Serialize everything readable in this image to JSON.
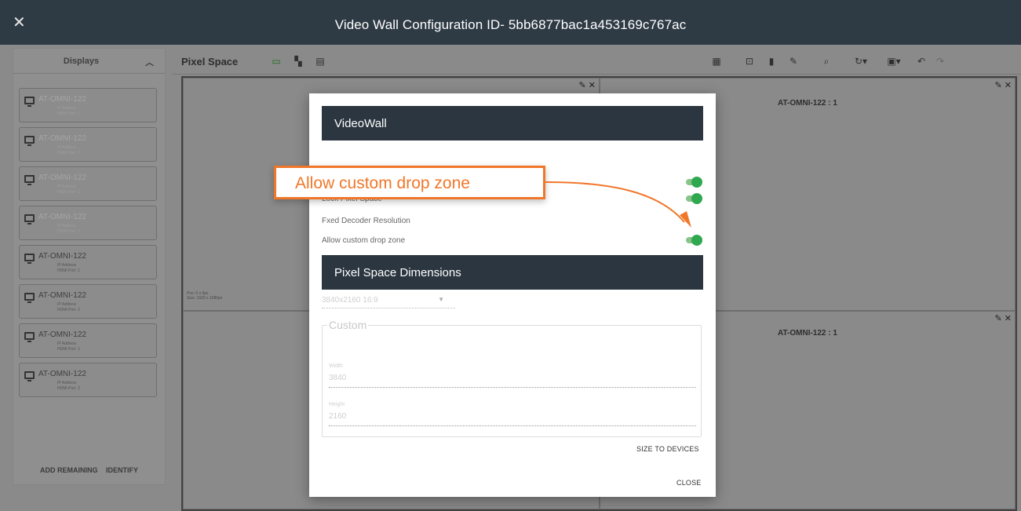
{
  "window": {
    "title": "Video Wall Configuration ID- 5bb6877bac1a453169c767ac",
    "close_icon": "close-icon"
  },
  "sidebar": {
    "header": "Displays",
    "collapse_icon": "chevron-up-icon",
    "items": [
      {
        "name": "AT-OMNI-122",
        "ip_label": "IP Address",
        "port_label": "HDMI Port",
        "port": "1"
      },
      {
        "name": "AT-OMNI-122",
        "ip_label": "IP Address",
        "port_label": "HDMI Port",
        "port": "1"
      },
      {
        "name": "AT-OMNI-122",
        "ip_label": "IP Address",
        "port_label": "HDMI Port",
        "port": "1"
      },
      {
        "name": "AT-OMNI-122",
        "ip_label": "IP Address",
        "port_label": "HDMI Port",
        "port": "1"
      },
      {
        "name": "AT-OMNI-122",
        "ip_label": "IP Address",
        "port_label": "HDMI Port",
        "port": "1"
      },
      {
        "name": "AT-OMNI-122",
        "ip_label": "IP Address",
        "port_label": "HDMI Port",
        "port": "2"
      },
      {
        "name": "AT-OMNI-122",
        "ip_label": "IP Address",
        "port_label": "HDMI Port",
        "port": "1"
      },
      {
        "name": "AT-OMNI-122",
        "ip_label": "IP Address",
        "port_label": "HDMI Port",
        "port": "2"
      }
    ],
    "add_remaining": "ADD REMAINING",
    "identify": "IDENTIFY"
  },
  "toolbar": {
    "title": "Pixel Space",
    "left_icons": [
      "monitor-icon",
      "grid-4-icon",
      "grid-list-icon"
    ],
    "right_icons": [
      "grid-9-icon",
      "lock-icon",
      "trash-icon",
      "pencil-icon",
      "zoom-icon",
      "rotate-icon",
      "save-icon",
      "undo-icon",
      "redo-icon"
    ]
  },
  "canvas": {
    "cells": [
      {
        "label": "",
        "pos": "Pos: 0 x 0px",
        "size": "Size: 1920 x 1080px"
      },
      {
        "label": "AT-OMNI-122 : 1"
      },
      {
        "label": ""
      },
      {
        "label": "AT-OMNI-122 : 1"
      }
    ]
  },
  "modal": {
    "header": "VideoWall",
    "rows": [
      {
        "label": "Lock Pixel Space",
        "enabled": true
      },
      {
        "label": "Fxed Decoder Resolution"
      },
      {
        "label": "Allow custom drop zone",
        "enabled": true
      }
    ],
    "dimensions_header": "Pixel Space Dimensions",
    "preset_value": "3840x2160 16:9",
    "custom_legend": "Custom",
    "width_label": "Width",
    "width_value": "3840",
    "height_label": "Height",
    "height_value": "2160",
    "size_to_devices": "SIZE TO DEVICES",
    "close": "CLOSE"
  },
  "callout": {
    "text": "Allow custom drop zone",
    "color": "#f0772a"
  }
}
